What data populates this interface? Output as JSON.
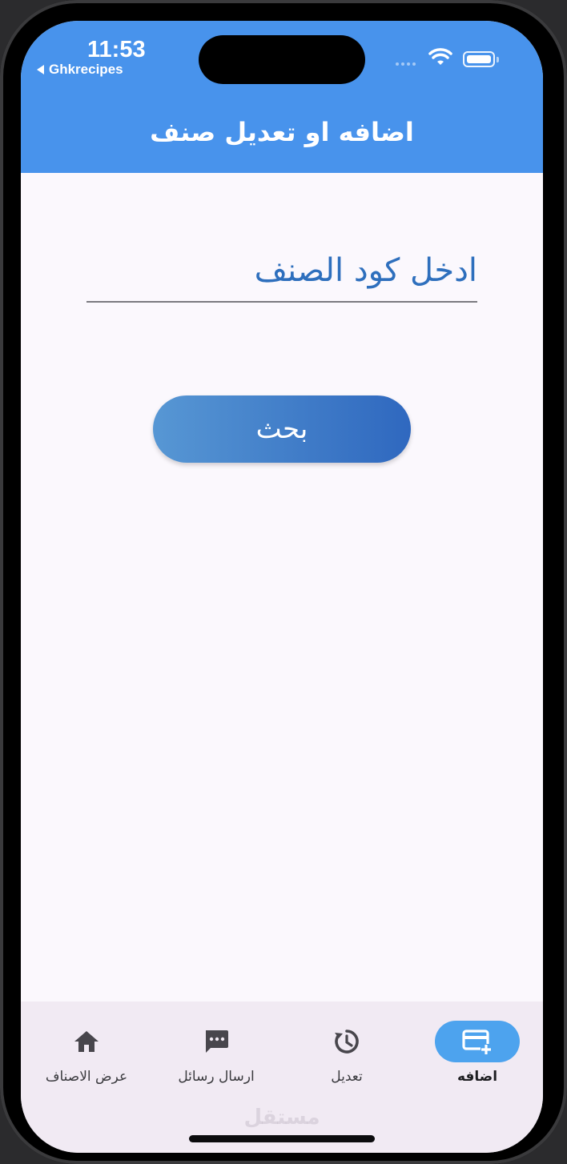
{
  "status_bar": {
    "time": "11:53",
    "back_app": "Ghkrecipes"
  },
  "appbar": {
    "title": "اضافه او تعديل صنف",
    "color": "#4893ec"
  },
  "form": {
    "code_placeholder": "ادخل كود الصنف",
    "code_value": "",
    "search_label": "بحث"
  },
  "bottom_nav": {
    "items": [
      {
        "label": "عرض الاصناف",
        "icon": "home-icon",
        "active": false
      },
      {
        "label": "ارسال رسائل",
        "icon": "chat-bubble-icon",
        "active": false
      },
      {
        "label": "تعديل",
        "icon": "history-icon",
        "active": false
      },
      {
        "label": "اضافه",
        "icon": "add-card-icon",
        "active": true
      }
    ],
    "active_color": "#4da3ee"
  },
  "watermark": "مستقل"
}
